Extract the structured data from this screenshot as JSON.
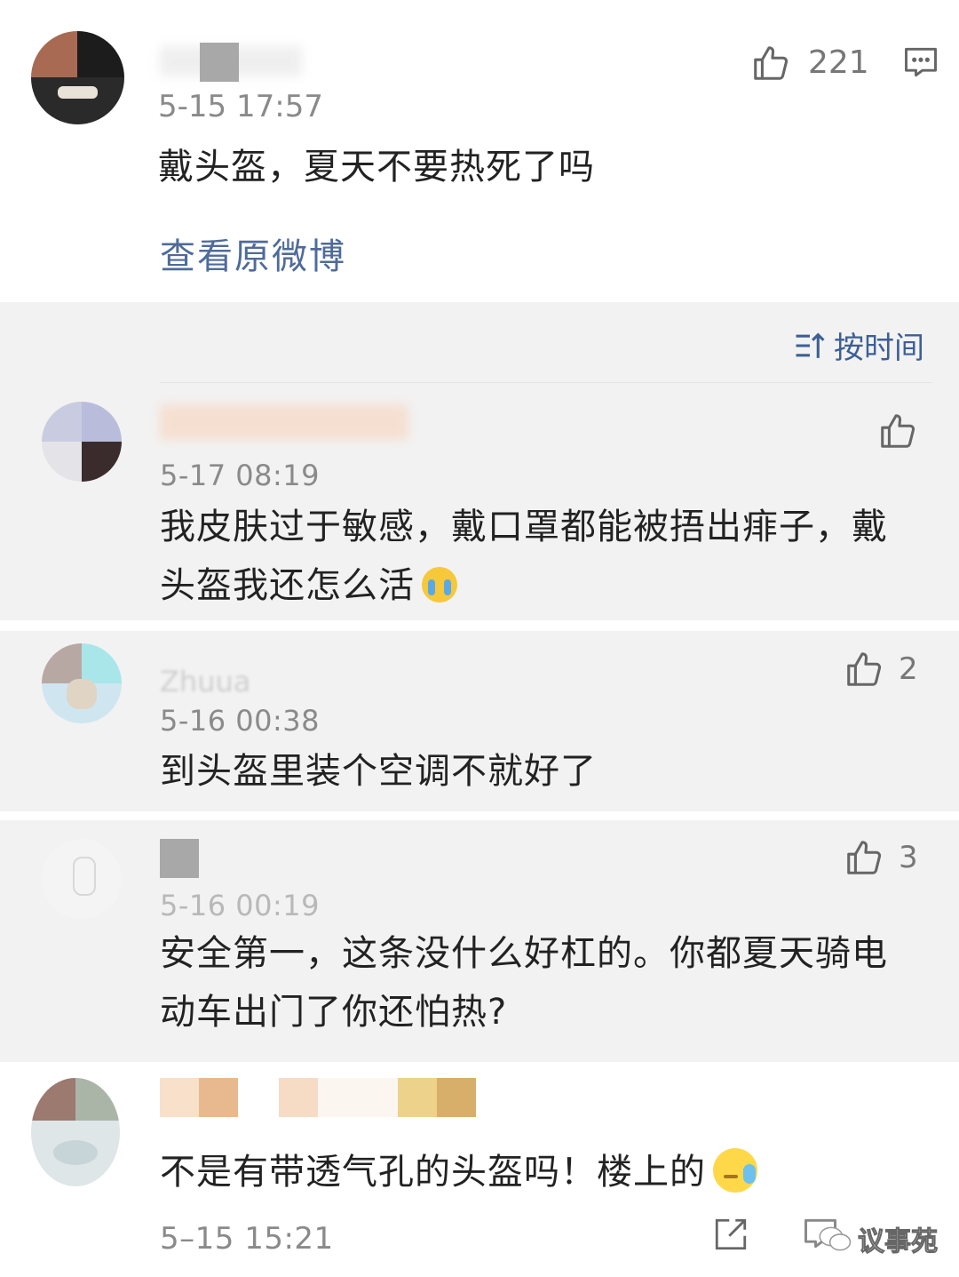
{
  "main_post": {
    "like_count": "221",
    "time": "5-15 17:57",
    "text": "戴头盔，夏天不要热死了吗",
    "view_original_link": "查看原微博"
  },
  "sort": {
    "label": "按时间"
  },
  "comments": [
    {
      "time": "5-17 08:19",
      "text_line1": "我皮肤过于敏感，戴口罩都能被捂出痱子，戴",
      "text_line2": "头盔我还怎么活",
      "emoji": "crying-face",
      "likes": ""
    },
    {
      "username_fragment": "Zhuua",
      "time": "5-16 00:38",
      "text": "到头盔里装个空调不就好了",
      "likes": "2"
    },
    {
      "time": "5-16 00:19",
      "text_line1": "安全第一，这条没什么好杠的。你都夏天骑电",
      "text_line2": "动车出门了你还怕热?",
      "likes": "3"
    },
    {
      "time": "5–15 15:21",
      "text": "不是有带透气孔的头盔吗！楼上的",
      "emoji": "sweat-face"
    }
  ],
  "watermark": "议事苑",
  "colors": {
    "accent_link": "#4e6b9a",
    "sort_blue": "#3d5f95",
    "gray_bg": "#f2f2f2",
    "text": "#222222",
    "muted": "#8a8a8a"
  }
}
